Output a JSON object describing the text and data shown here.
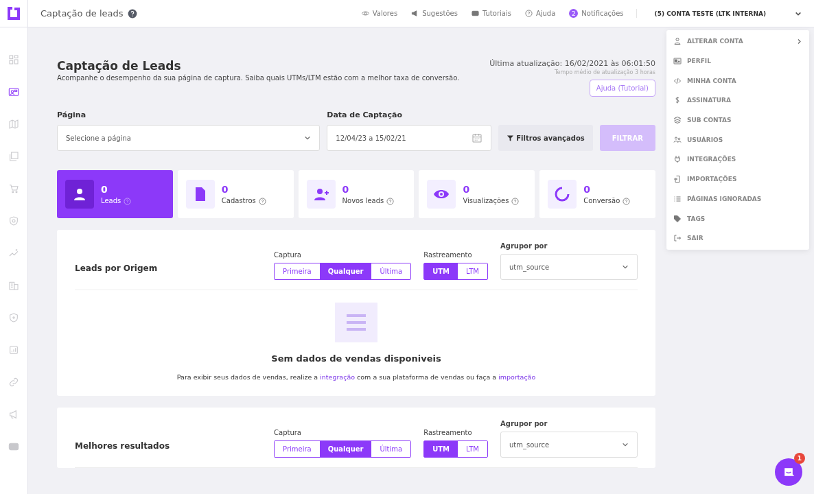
{
  "topbar": {
    "title": "Captação de leads",
    "nav": [
      {
        "label": "Valores"
      },
      {
        "label": "Sugestões"
      },
      {
        "label": "Tutoriais"
      },
      {
        "label": "Ajuda"
      },
      {
        "label": "Notificações",
        "badge": "2"
      }
    ],
    "account": "(5) CONTA TESTE (LTK INTERNA)"
  },
  "sidebar": {
    "items": [
      {
        "selected": false
      },
      {
        "selected": true
      },
      {
        "selected": false
      },
      {
        "selected": false
      },
      {
        "selected": false
      },
      {
        "selected": false
      },
      {
        "selected": false
      },
      {
        "selected": false
      },
      {
        "selected": false
      },
      {
        "selected": false
      },
      {
        "selected": false
      },
      {
        "selected": false
      },
      {
        "selected": false
      }
    ]
  },
  "header": {
    "title": "Captação de Leads",
    "subtitle": "Acompanhe o desempenho da sua página de captura. Saiba quais UTMs/LTM estão com a melhor taxa de conversão.",
    "last_update": "Última atualização: 16/02/2021 às 06:01:50",
    "avg_update": "Tempo médio de atualização 3 horas",
    "help_button": "Ajuda (Tutorial)"
  },
  "filters": {
    "page_label": "Página",
    "page_placeholder": "Selecione a página",
    "date_label": "Data de Captação",
    "date_value": "12/04/23 a 15/02/21",
    "advanced": "Filtros avançados",
    "apply": "FILTRAR"
  },
  "cards": [
    {
      "value": "0",
      "label": "Leads",
      "selected": true
    },
    {
      "value": "0",
      "label": "Cadastros",
      "selected": false
    },
    {
      "value": "0",
      "label": "Novos leads",
      "selected": false
    },
    {
      "value": "0",
      "label": "Visualizações",
      "selected": false
    },
    {
      "value": "0",
      "label": "Conversão",
      "selected": false
    }
  ],
  "sections": [
    {
      "title": "Leads por Origem",
      "capture_label": "Captura",
      "capture": [
        {
          "label": "Primeira",
          "selected": false
        },
        {
          "label": "Qualquer",
          "selected": true
        },
        {
          "label": "Última",
          "selected": false
        }
      ],
      "tracking_label": "Rastreamento",
      "tracking": [
        {
          "label": "UTM",
          "selected": true
        },
        {
          "label": "LTM",
          "selected": false
        }
      ],
      "group_label": "Agrupor por",
      "group_value": "utm_source",
      "empty": {
        "title": "Sem dados de vendas disponiveis",
        "text_before": "Para exibir seus dados de vendas, realize a",
        "link1": "integração",
        "text_middle": "com a sua plataforma de vendas ou faça a",
        "link2": "importação"
      }
    },
    {
      "title": "Melhores resultados",
      "capture_label": "Captura",
      "capture": [
        {
          "label": "Primeira",
          "selected": false
        },
        {
          "label": "Qualquer",
          "selected": true
        },
        {
          "label": "Última",
          "selected": false
        }
      ],
      "tracking_label": "Rastreamento",
      "tracking": [
        {
          "label": "UTM",
          "selected": true
        },
        {
          "label": "LTM",
          "selected": false
        }
      ],
      "group_label": "Agrupor por",
      "group_value": "utm_source"
    }
  ],
  "account_menu": [
    {
      "label": "ALTERAR CONTA",
      "submenu": true
    },
    {
      "label": "PERFIL",
      "submenu": false
    },
    {
      "label": "MINHA CONTA",
      "submenu": false
    },
    {
      "label": "ASSINATURA",
      "submenu": false
    },
    {
      "label": "SUB CONTAS",
      "submenu": false
    },
    {
      "label": "USUÁRIOS",
      "submenu": false
    },
    {
      "label": "INTEGRAÇÕES",
      "submenu": false
    },
    {
      "label": "IMPORTAÇÕES",
      "submenu": false
    },
    {
      "label": "PÁGINAS IGNORADAS",
      "submenu": false
    },
    {
      "label": "TAGS",
      "submenu": false
    },
    {
      "label": "SAIR",
      "submenu": false
    }
  ],
  "chat": {
    "badge": "1"
  }
}
